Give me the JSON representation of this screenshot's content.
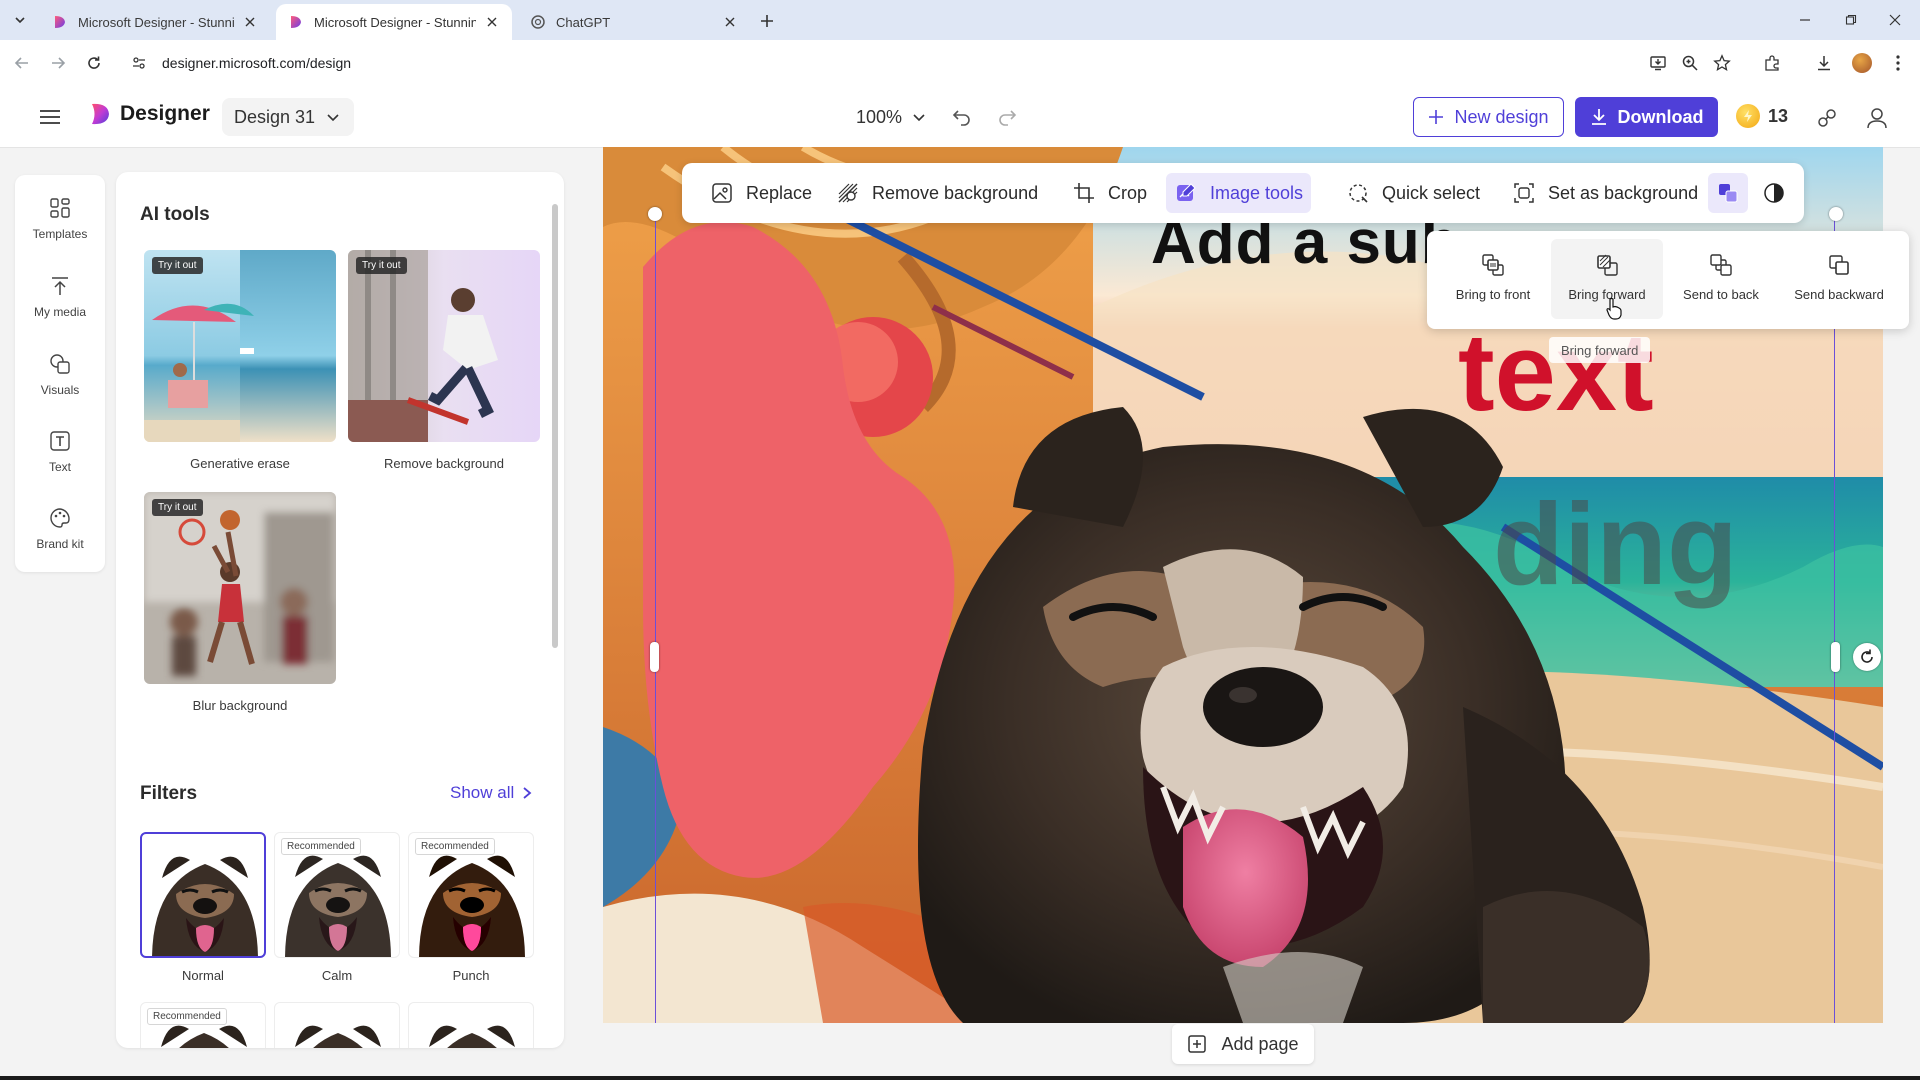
{
  "browser": {
    "tabs": [
      {
        "title": "Microsoft Designer - Stunning designs in a flash",
        "active": false
      },
      {
        "title": "Microsoft Designer - Stunning designs in a flash",
        "active": true
      },
      {
        "title": "ChatGPT",
        "active": false
      }
    ],
    "url": "designer.microsoft.com/design"
  },
  "header": {
    "brand": "Designer",
    "design_name": "Design 31",
    "zoom": "100%",
    "new_design_label": "New design",
    "download_label": "Download",
    "credits": "13"
  },
  "leftnav": {
    "items": [
      {
        "label": "Templates",
        "icon": "templates-icon"
      },
      {
        "label": "My media",
        "icon": "upload-icon"
      },
      {
        "label": "Visuals",
        "icon": "shapes-icon"
      },
      {
        "label": "Text",
        "icon": "text-icon"
      },
      {
        "label": "Brand kit",
        "icon": "palette-icon"
      }
    ]
  },
  "sidepanel": {
    "ai_tools_title": "AI tools",
    "try_badge": "Try it out",
    "ai_tools": [
      {
        "label": "Generative erase"
      },
      {
        "label": "Remove background"
      },
      {
        "label": "Blur background"
      }
    ],
    "filters_title": "Filters",
    "show_all": "Show all",
    "recommended_badge": "Recommended",
    "filters": [
      {
        "label": "Normal",
        "selected": true,
        "recommended": false
      },
      {
        "label": "Calm",
        "selected": false,
        "recommended": true
      },
      {
        "label": "Punch",
        "selected": false,
        "recommended": true
      },
      {
        "label": "",
        "selected": false,
        "recommended": true
      },
      {
        "label": "",
        "selected": false,
        "recommended": false
      },
      {
        "label": "",
        "selected": false,
        "recommended": false
      }
    ]
  },
  "toolbar": {
    "replace": "Replace",
    "remove_background": "Remove background",
    "crop": "Crop",
    "image_tools": "Image tools",
    "quick_select": "Quick select",
    "set_as_background": "Set as background"
  },
  "arrange": {
    "bring_to_front": "Bring to front",
    "bring_forward": "Bring forward",
    "send_to_back": "Send to back",
    "send_backward": "Send backward",
    "tooltip": "Bring forward"
  },
  "canvas": {
    "subheading_text": "Add a sub",
    "body_text": "text",
    "heading_text": "ding"
  },
  "add_page": "Add page",
  "colors": {
    "accent": "#4f3fd8",
    "blob": "#ee6268",
    "text_red": "#d0112b"
  }
}
